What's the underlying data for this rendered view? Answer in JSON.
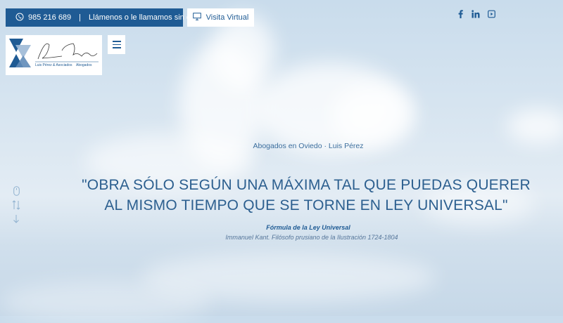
{
  "topbar": {
    "phone": "985 216 689",
    "separator": "|",
    "call_text": "Llámenos o le llamamos sin compromiso",
    "virtual_visit": "Visita Virtual"
  },
  "social": {
    "icons": [
      "facebook-icon",
      "linkedin-icon",
      "youtube-icon"
    ]
  },
  "logo": {
    "name": "Luis Pérez & Asociados",
    "role": "Abogados"
  },
  "hero": {
    "subtitle": "Abogados en Oviedo · Luis Pérez",
    "quote": "\"OBRA SÓLO SEGÚN UNA MÁXIMA TAL QUE PUEDAS QUERER AL MISMO TIEMPO QUE SE TORNE EN LEY UNIVERSAL\"",
    "formula": "Fórmula de la Ley Universal",
    "author": "Immanuel Kant. Filósofo prusiano de la Ilustración 1724-1804"
  },
  "colors": {
    "brand_blue": "#1f5b94",
    "sky": "#d9e6f1"
  }
}
